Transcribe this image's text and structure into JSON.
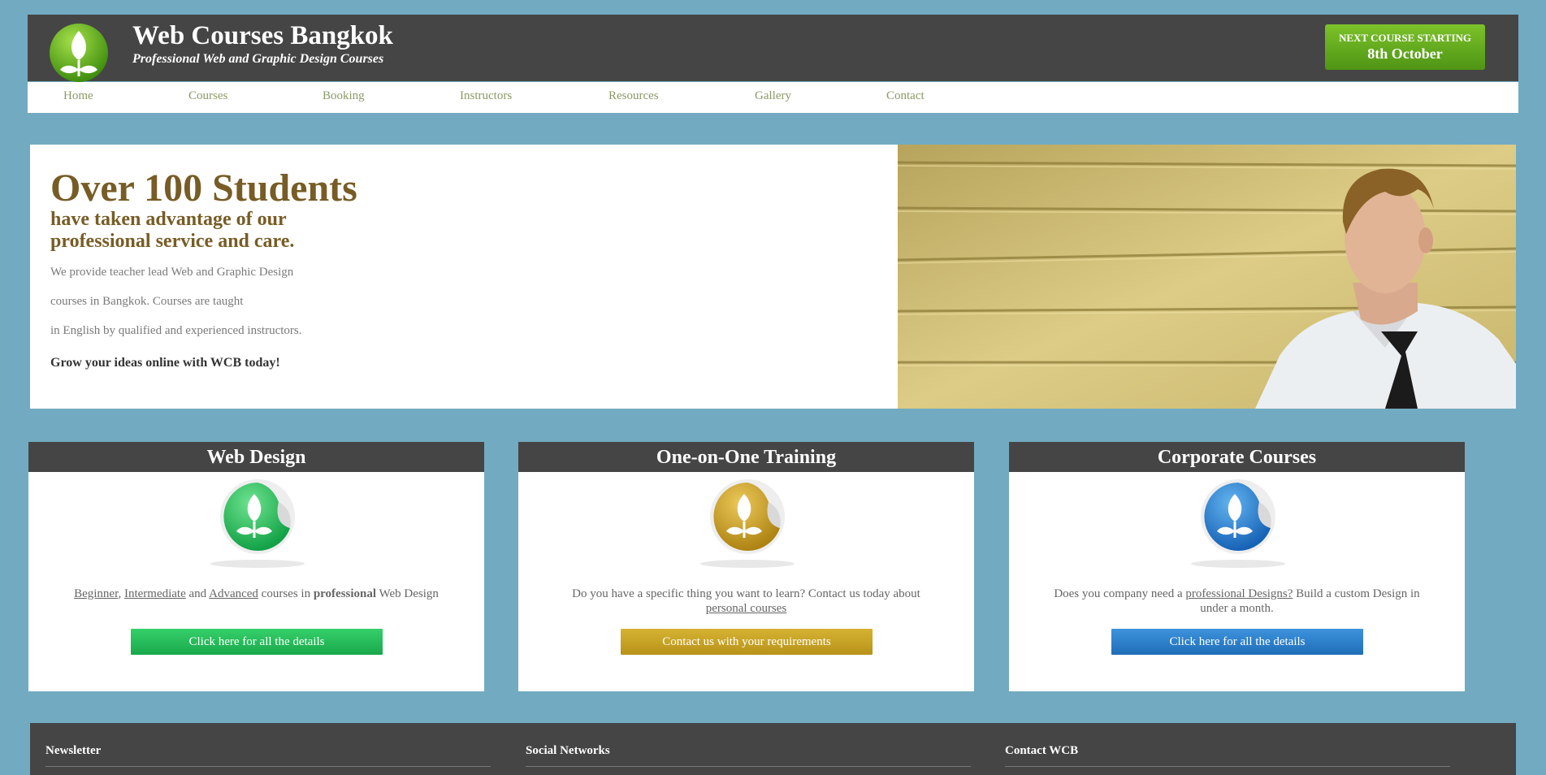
{
  "header": {
    "title": "Web Courses Bangkok",
    "tagline": "Professional Web and Graphic Design Courses",
    "next_course_label": "NEXT COURSE STARTING",
    "next_course_date": "8th October"
  },
  "nav": {
    "items": [
      "Home",
      "Courses",
      "Booking",
      "Instructors",
      "Resources",
      "Gallery",
      "Contact"
    ]
  },
  "hero": {
    "headline": "Over 100 Students",
    "subheadline_1": "have taken advantage of our",
    "subheadline_2": "professional service and care.",
    "lines": [
      "We provide teacher lead Web and Graphic Design",
      "courses in Bangkok. Courses are taught",
      "in English by qualified and experienced instructors."
    ],
    "cta": "Grow your ideas online with WCB today!"
  },
  "boxes": [
    {
      "title": "Web Design",
      "accent": "#2fbf57",
      "text": {
        "a": "Beginner",
        "sep1": ", ",
        "b": "Intermediate",
        "sep2": " and ",
        "c": "Advanced",
        "mid": " courses in ",
        "d": "professional",
        "end": " Web Design"
      },
      "button": "Click here for all the details"
    },
    {
      "title": "One-on-One Training",
      "accent": "#c9a424",
      "text": {
        "pre": "Do you have a specific thing you want to learn? Contact us today about ",
        "link": "personal courses"
      },
      "button": "Contact us with your requirements"
    },
    {
      "title": "Corporate Courses",
      "accent": "#2a7fcf",
      "text": {
        "pre": "Does you company need a ",
        "link": "professional Designs?",
        "post": " Build a custom Design in under a month."
      },
      "button": "Click here for all the details"
    }
  ],
  "footer": {
    "newsletter": "Newsletter",
    "social": "Social Networks",
    "contact": "Contact WCB"
  }
}
